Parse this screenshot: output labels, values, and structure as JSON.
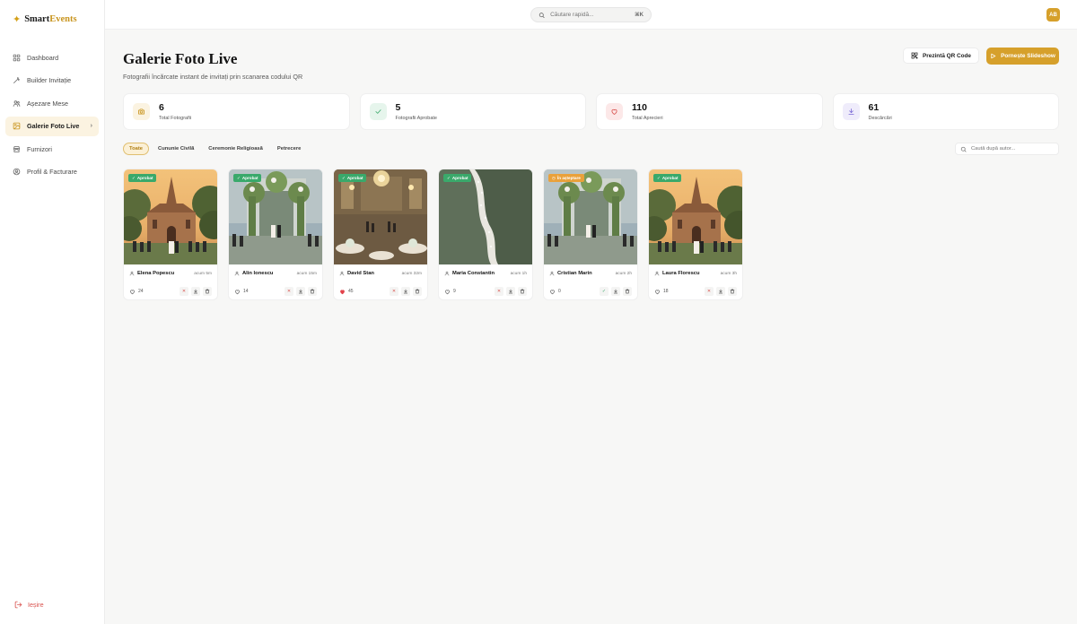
{
  "brand": {
    "star": "✦",
    "name_a": "Smart",
    "name_b": "Events"
  },
  "nav": {
    "items": [
      {
        "label": "Dashboard",
        "icon": "grid-icon"
      },
      {
        "label": "Builder Invitație",
        "icon": "wand-icon"
      },
      {
        "label": "Așezare Mese",
        "icon": "users-icon"
      },
      {
        "label": "Galerie Foto Live",
        "icon": "image-icon",
        "active": true
      },
      {
        "label": "Furnizori",
        "icon": "store-icon"
      },
      {
        "label": "Profil & Facturare",
        "icon": "user-circle-icon"
      }
    ],
    "logout": "Ieșire"
  },
  "topbar": {
    "search_placeholder": "Căutare rapidă...",
    "shortcut": "⌘K",
    "avatar": "AB"
  },
  "page": {
    "title": "Galerie Foto Live",
    "subtitle": "Fotografii încărcate instant de invitați prin scanarea codului QR",
    "qr_button": "Prezintă QR Code",
    "slideshow_button": "Pornește Slideshow"
  },
  "stats": [
    {
      "value": "6",
      "label": "Total Fotografii",
      "icon": "camera-icon",
      "color": "#c9951f",
      "bg": "#fbf3e1"
    },
    {
      "value": "5",
      "label": "Fotografii Aprobate",
      "icon": "check-icon",
      "color": "#3aa96b",
      "bg": "#e6f5ec"
    },
    {
      "value": "110",
      "label": "Total Aprecieri",
      "icon": "heart-icon",
      "color": "#d9534f",
      "bg": "#fce8e8"
    },
    {
      "value": "61",
      "label": "Descărcări",
      "icon": "download-icon",
      "color": "#7b6ad6",
      "bg": "#efecfb"
    }
  ],
  "filters": [
    "Toate",
    "Cununie Civilă",
    "Ceremonie Religioasă",
    "Petrecere"
  ],
  "author_search_placeholder": "Caută după autor...",
  "photos": [
    {
      "author": "Elena Popescu",
      "time": "acum 5m",
      "likes": "24",
      "status": "Aprobat",
      "approved": true,
      "scene": "cathedral",
      "liked": false
    },
    {
      "author": "Alin Ionescu",
      "time": "acum 15m",
      "likes": "14",
      "status": "Aprobat",
      "approved": true,
      "scene": "arch",
      "liked": false
    },
    {
      "author": "David Stan",
      "time": "acum 32m",
      "likes": "45",
      "status": "Aprobat",
      "approved": true,
      "scene": "ballroom",
      "liked": true
    },
    {
      "author": "Maria Constantin",
      "time": "acum 1h",
      "likes": "9",
      "status": "Aprobat",
      "approved": true,
      "scene": "dress",
      "liked": false
    },
    {
      "author": "Cristian Marin",
      "time": "acum 2h",
      "likes": "0",
      "status": "În așteptare",
      "approved": false,
      "scene": "arch",
      "liked": false
    },
    {
      "author": "Laura Florescu",
      "time": "acum 3h",
      "likes": "18",
      "status": "Aprobat",
      "approved": true,
      "scene": "cathedral",
      "liked": false
    }
  ]
}
